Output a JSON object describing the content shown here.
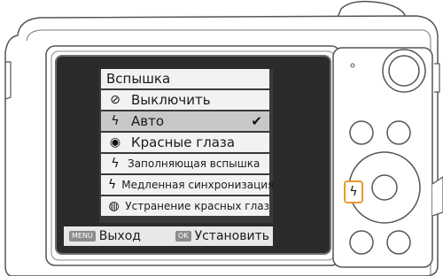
{
  "menu": {
    "title": "Вспышка",
    "items": [
      {
        "icon": "⚡",
        "icon_name": "flash-off-icon",
        "label": "Выключить",
        "selected": false
      },
      {
        "icon": "⚡",
        "icon_name": "flash-auto-icon",
        "label": "Авто",
        "selected": true
      },
      {
        "icon": "◉",
        "icon_name": "red-eye-icon",
        "label": "Красные глаза",
        "selected": false
      },
      {
        "icon": "⚡",
        "icon_name": "fill-flash-icon",
        "label": "Заполняющая вспышка",
        "selected": false
      },
      {
        "icon": "⚡",
        "icon_name": "slow-sync-icon",
        "label": "Медленная синхронизация",
        "selected": false
      },
      {
        "icon": "◉",
        "icon_name": "red-eye-fix-icon",
        "label": "Устранение красных глаз",
        "selected": false
      }
    ],
    "check_mark": "✔"
  },
  "bottom_bar": {
    "menu_key": "MENU",
    "exit_label": "Выход",
    "ok_key": "OK",
    "set_label": "Установить"
  },
  "camera": {
    "flash_button_icon": "ϟ",
    "highlight_color": "#e89b2a"
  }
}
